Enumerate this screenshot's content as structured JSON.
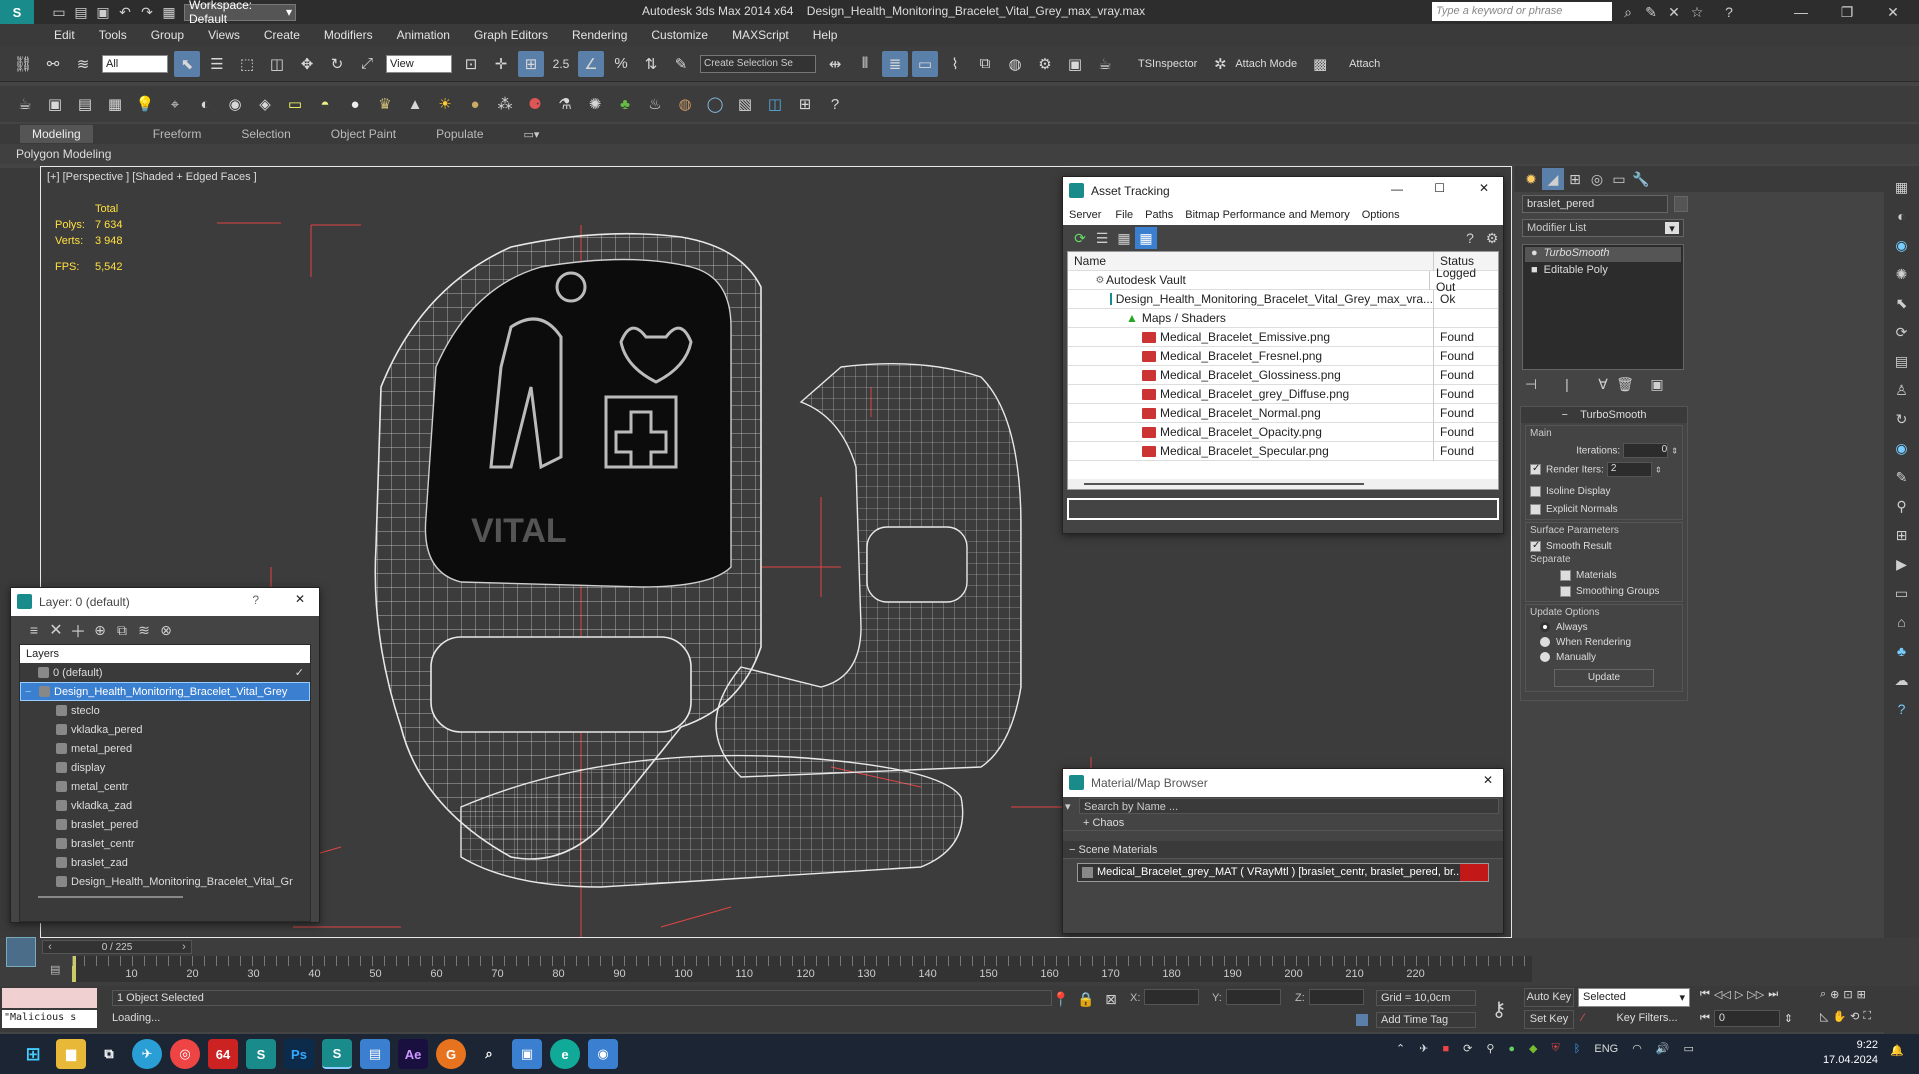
{
  "titlebar": {
    "workspace": "Workspace: Default",
    "app": "Autodesk 3ds Max  2014 x64",
    "file": "Design_Health_Monitoring_Bracelet_Vital_Grey_max_vray.max",
    "search_placeholder": "Type a keyword or phrase"
  },
  "menu": [
    "Edit",
    "Tools",
    "Group",
    "Views",
    "Create",
    "Modifiers",
    "Animation",
    "Graph Editors",
    "Rendering",
    "Customize",
    "MAXScript",
    "Help"
  ],
  "toolbar": {
    "selection_filter": "All",
    "ref_coord": "View",
    "snap_value": "2.5",
    "named_selection_placeholder": "Create Selection Se",
    "ts_inspector": "TSInspector",
    "attach_mode": "Attach Mode",
    "attach": "Attach"
  },
  "ribbon": {
    "tabs": [
      "Modeling",
      "Freeform",
      "Selection",
      "Object Paint",
      "Populate"
    ],
    "sub": "Polygon Modeling"
  },
  "viewport": {
    "label": "[+] [Perspective ] [Shaded + Edged Faces ]",
    "stats": {
      "total_label": "Total",
      "polys_label": "Polys:",
      "polys": "7 634",
      "verts_label": "Verts:",
      "verts": "3 948",
      "fps_label": "FPS:",
      "fps": "5,542"
    },
    "screen_text": "VITAL"
  },
  "asset_tracking": {
    "title": "Asset Tracking",
    "menu": [
      "Server",
      "File",
      "Paths",
      "Bitmap Performance and Memory",
      "Options"
    ],
    "col_name": "Name",
    "col_status": "Status",
    "rows": [
      {
        "name": "Autodesk Vault",
        "status": "Logged Out"
      },
      {
        "name": "Design_Health_Monitoring_Bracelet_Vital_Grey_max_vra...",
        "status": "Ok"
      },
      {
        "name": "Maps / Shaders",
        "status": ""
      },
      {
        "name": "Medical_Bracelet_Emissive.png",
        "status": "Found"
      },
      {
        "name": "Medical_Bracelet_Fresnel.png",
        "status": "Found"
      },
      {
        "name": "Medical_Bracelet_Glossiness.png",
        "status": "Found"
      },
      {
        "name": "Medical_Bracelet_grey_Diffuse.png",
        "status": "Found"
      },
      {
        "name": "Medical_Bracelet_Normal.png",
        "status": "Found"
      },
      {
        "name": "Medical_Bracelet_Opacity.png",
        "status": "Found"
      },
      {
        "name": "Medical_Bracelet_Specular.png",
        "status": "Found"
      }
    ]
  },
  "material_browser": {
    "title": "Material/Map Browser",
    "search_placeholder": "Search by Name ...",
    "chaos": "+ Chaos",
    "scene_materials": "Scene Materials",
    "material": "Medical_Bracelet_grey_MAT  ( VRayMtl ) [braslet_centr, braslet_pered, br..."
  },
  "layers": {
    "title": "Layer: 0 (default)",
    "header": "Layers",
    "items": [
      {
        "name": "0 (default)",
        "level": 0
      },
      {
        "name": "Design_Health_Monitoring_Bracelet_Vital_Grey",
        "level": 0,
        "selected": true
      },
      {
        "name": "steclo",
        "level": 1
      },
      {
        "name": "vkladka_pered",
        "level": 1
      },
      {
        "name": "metal_pered",
        "level": 1
      },
      {
        "name": "display",
        "level": 1
      },
      {
        "name": "metal_centr",
        "level": 1
      },
      {
        "name": "vkladka_zad",
        "level": 1
      },
      {
        "name": "braslet_pered",
        "level": 1
      },
      {
        "name": "braslet_centr",
        "level": 1
      },
      {
        "name": "braslet_zad",
        "level": 1
      },
      {
        "name": "Design_Health_Monitoring_Bracelet_Vital_Gr",
        "level": 1
      }
    ]
  },
  "command_panel": {
    "object_name": "braslet_pered",
    "modifier_list": "Modifier List",
    "stack": [
      "TurboSmooth",
      "Editable Poly"
    ],
    "rollout_title": "TurboSmooth",
    "main": "Main",
    "iterations_label": "Iterations:",
    "iterations": "0",
    "render_iters_label": "Render Iters:",
    "render_iters": "2",
    "isoline": "Isoline Display",
    "explicit_normals": "Explicit Normals",
    "surface_params": "Surface Parameters",
    "smooth_result": "Smooth Result",
    "separate": "Separate",
    "materials": "Materials",
    "smoothing_groups": "Smoothing Groups",
    "update_options": "Update Options",
    "always": "Always",
    "when_rendering": "When Rendering",
    "manually": "Manually",
    "update": "Update"
  },
  "timeline": {
    "frame": "0 / 225",
    "ticks": [
      "10",
      "20",
      "30",
      "40",
      "50",
      "60",
      "70",
      "80",
      "90",
      "100",
      "110",
      "120",
      "130",
      "140",
      "150",
      "160",
      "170",
      "180",
      "190",
      "200",
      "210",
      "220"
    ]
  },
  "status": {
    "selected": "1 Object Selected",
    "loading": "Loading...",
    "script": "\"Malicious s",
    "x_label": "X:",
    "y_label": "Y:",
    "z_label": "Z:",
    "grid": "Grid = 10,0cm",
    "add_time_tag": "Add Time Tag",
    "auto_key": "Auto Key",
    "set_key": "Set Key",
    "key_mode": "Selected",
    "key_filters": "Key Filters...",
    "frame_field": "0"
  },
  "taskbar": {
    "lang": "ENG",
    "time": "9:22",
    "date": "17.04.2024"
  },
  "colors": {
    "accent_blue": "#3b7fd0",
    "viewport_bg": "#3c3c3c",
    "wire": "#e6e6e6",
    "taskbar": "#1b2533"
  }
}
